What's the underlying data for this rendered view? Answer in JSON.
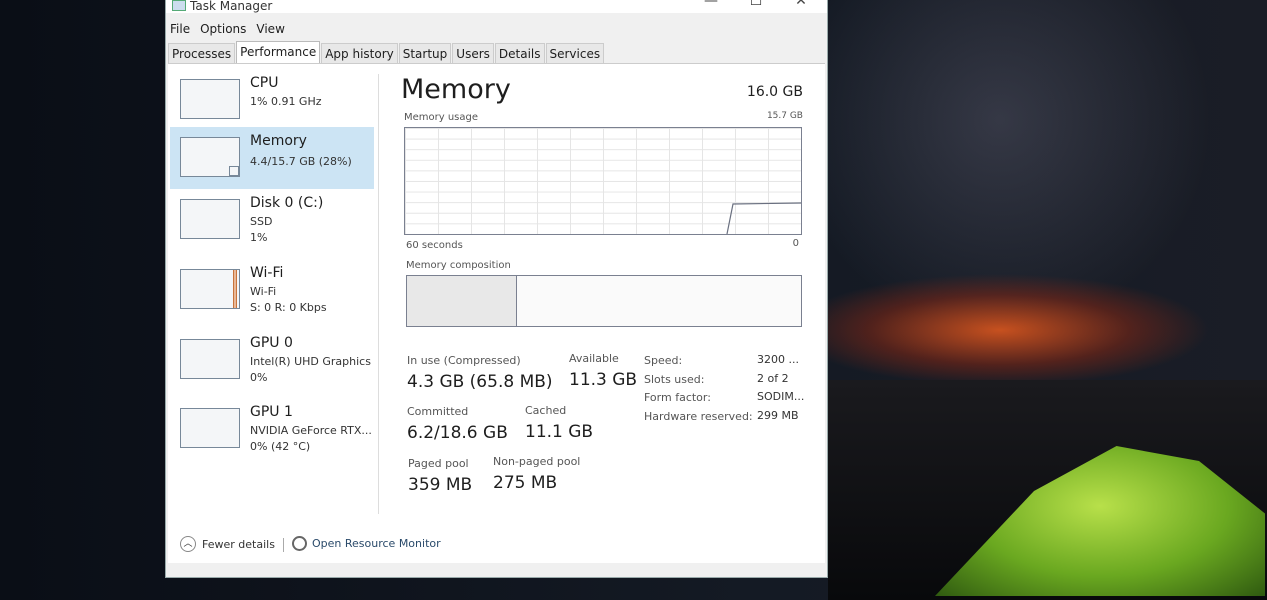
{
  "window": {
    "title": "Task Manager",
    "minimize": "—",
    "maximize": "☐",
    "close": "✕"
  },
  "menu": [
    "File",
    "Options",
    "View"
  ],
  "tabs": [
    "Processes",
    "Performance",
    "App history",
    "Startup",
    "Users",
    "Details",
    "Services"
  ],
  "active_tab": "Performance",
  "sidebar": [
    {
      "name": "CPU",
      "line1": "1% 0.91 GHz",
      "line2": ""
    },
    {
      "name": "Memory",
      "line1": "4.4/15.7 GB (28%)",
      "line2": "",
      "selected": true
    },
    {
      "name": "Disk 0 (C:)",
      "line1": "SSD",
      "line2": "1%"
    },
    {
      "name": "Wi-Fi",
      "line1": "Wi-Fi",
      "line2": "S: 0 R: 0 Kbps"
    },
    {
      "name": "GPU 0",
      "line1": "Intel(R) UHD Graphics",
      "line2": "0%"
    },
    {
      "name": "GPU 1",
      "line1": "NVIDIA GeForce RTX...",
      "line2": "0% (42 °C)"
    }
  ],
  "main": {
    "title": "Memory",
    "total": "16.0 GB",
    "usage_label": "Memory usage",
    "usage_max": "15.7 GB",
    "time_label": "60 seconds",
    "time_end": "0",
    "composition_label": "Memory composition",
    "in_use_fraction": 0.28,
    "stats": {
      "in_use_label": "In use (Compressed)",
      "in_use": "4.3 GB (65.8 MB)",
      "available_label": "Available",
      "available": "11.3 GB",
      "committed_label": "Committed",
      "committed": "6.2/18.6 GB",
      "cached_label": "Cached",
      "cached": "11.1 GB",
      "paged_label": "Paged pool",
      "paged": "359 MB",
      "nonpaged_label": "Non-paged pool",
      "nonpaged": "275 MB"
    },
    "details": [
      {
        "k": "Speed:",
        "v": "3200 ..."
      },
      {
        "k": "Slots used:",
        "v": "2 of 2"
      },
      {
        "k": "Form factor:",
        "v": "SODIM..."
      },
      {
        "k": "Hardware reserved:",
        "v": "299 MB"
      }
    ]
  },
  "footer": {
    "fewer": "Fewer details",
    "monitor": "Open Resource Monitor"
  },
  "colors": {
    "accent": "#cce4f4",
    "wifi": "#c8743c"
  }
}
